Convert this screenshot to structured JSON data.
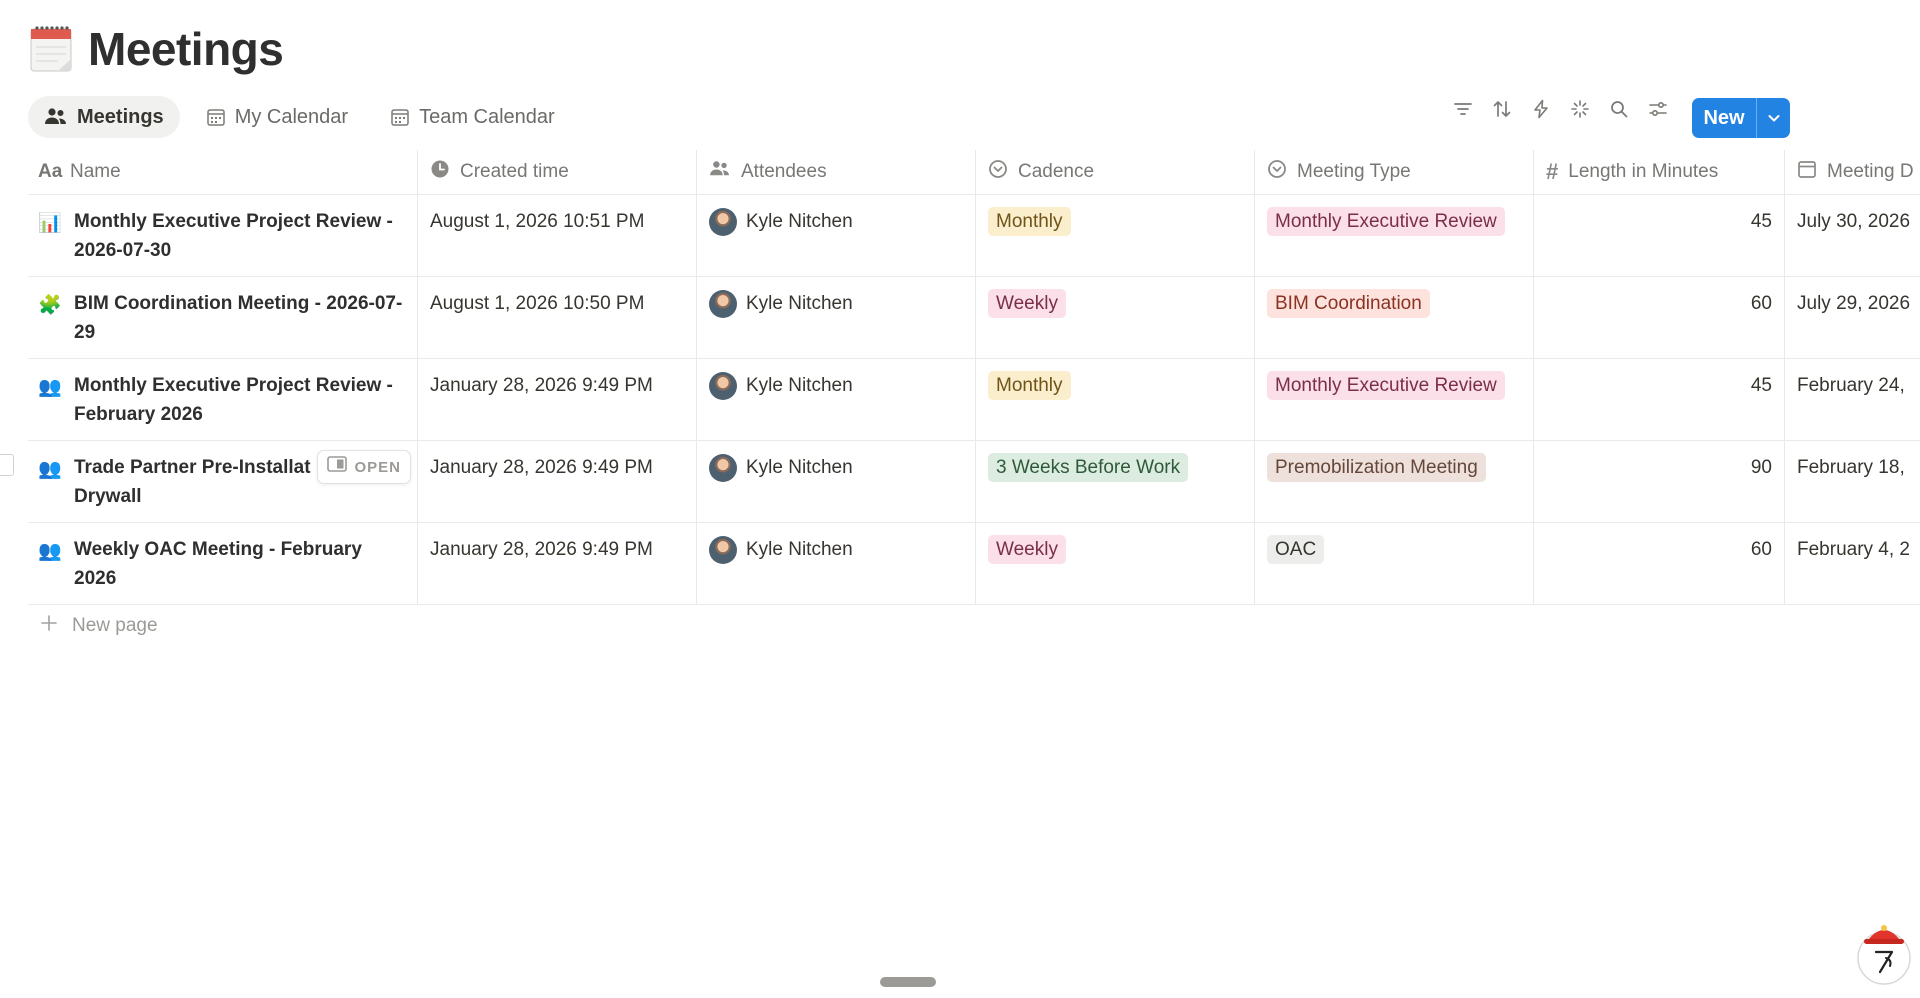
{
  "page": {
    "title": "Meetings"
  },
  "tabs": [
    {
      "label": "Meetings",
      "icon": "people-icon",
      "active": true
    },
    {
      "label": "My Calendar",
      "icon": "calendar-icon",
      "active": false
    },
    {
      "label": "Team Calendar",
      "icon": "calendar-icon",
      "active": false
    }
  ],
  "toolbar": {
    "icons": [
      "filter-icon",
      "sort-icon",
      "automation-icon",
      "ai-sparkle-icon",
      "search-icon",
      "settings-icon"
    ],
    "new_label": "New"
  },
  "columns": [
    {
      "label": "Name",
      "icon": "Aa"
    },
    {
      "label": "Created time",
      "icon": "clock-icon"
    },
    {
      "label": "Attendees",
      "icon": "people-icon"
    },
    {
      "label": "Cadence",
      "icon": "select-icon"
    },
    {
      "label": "Meeting Type",
      "icon": "select-icon"
    },
    {
      "label": "Length in Minutes",
      "icon": "#"
    },
    {
      "label": "Meeting D",
      "icon": "calendar-icon"
    }
  ],
  "rows": [
    {
      "emoji": "📊",
      "name": "Monthly Executive Project Review - 2026-07-30",
      "created": "August 1, 2026 10:51 PM",
      "attendee": "Kyle Nitchen",
      "cadence": "Monthly",
      "cadence_bg": "#fbeecc",
      "cadence_fg": "#6f5318",
      "type": "Monthly Executive Review",
      "type_bg": "#fbe0ea",
      "type_fg": "#7b2e48",
      "length": "45",
      "date": "July 30, 2026"
    },
    {
      "emoji": "🧩",
      "name": "BIM Coordination Meeting - 2026-07-29",
      "created": "August 1, 2026 10:50 PM",
      "attendee": "Kyle Nitchen",
      "cadence": "Weekly",
      "cadence_bg": "#fbe0ea",
      "cadence_fg": "#7b2e48",
      "type": "BIM Coordination",
      "type_bg": "#fde2dd",
      "type_fg": "#8a3323",
      "length": "60",
      "date": "July 29, 2026"
    },
    {
      "emoji": "👥",
      "name": "Monthly Executive Project Review - February 2026",
      "created": "January 28, 2026 9:49 PM",
      "attendee": "Kyle Nitchen",
      "cadence": "Monthly",
      "cadence_bg": "#fbeecc",
      "cadence_fg": "#6f5318",
      "type": "Monthly Executive Review",
      "type_bg": "#fbe0ea",
      "type_fg": "#7b2e48",
      "length": "45",
      "date": "February 24,"
    },
    {
      "emoji": "👥",
      "name": "Trade Partner Pre-Installat Meeting - Drywall",
      "created": "January 28, 2026 9:49 PM",
      "attendee": "Kyle Nitchen",
      "cadence": "3 Weeks Before Work",
      "cadence_bg": "#dcece1",
      "cadence_fg": "#2f5a3a",
      "type": "Premobilization Meeting",
      "type_bg": "#eee0da",
      "type_fg": "#64473a",
      "length": "90",
      "date": "February 18,",
      "open_label": "OPEN"
    },
    {
      "emoji": "👥",
      "name": "Weekly OAC Meeting - February 2026",
      "created": "January 28, 2026 9:49 PM",
      "attendee": "Kyle Nitchen",
      "cadence": "Weekly",
      "cadence_bg": "#fbe0ea",
      "cadence_fg": "#7b2e48",
      "type": "OAC",
      "type_bg": "#ededeb",
      "type_fg": "#37352f",
      "length": "60",
      "date": "February 4, 2"
    }
  ],
  "new_page_label": "New page"
}
